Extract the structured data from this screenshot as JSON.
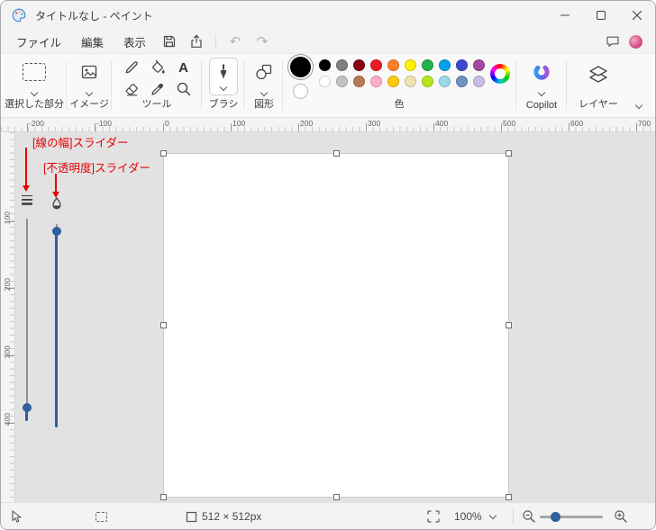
{
  "titlebar": {
    "title": "タイトルなし - ペイント"
  },
  "menubar": {
    "file": "ファイル",
    "edit": "編集",
    "view": "表示"
  },
  "glyphs": {
    "undo": "↶",
    "redo": "↷",
    "text_tool": "A"
  },
  "ribbon": {
    "selection_label": "選択した部分",
    "image_label": "イメージ",
    "tools_label": "ツール",
    "brushes_label": "ブラシ",
    "shapes_label": "図形",
    "colors_label": "色",
    "copilot_label": "Copilot",
    "layers_label": "レイヤー",
    "color1": "#000000",
    "color2": "#ffffff",
    "palette_row1": [
      "#000000",
      "#7f7f7f",
      "#880015",
      "#ed1c24",
      "#ff7f27",
      "#fff200",
      "#22b14c",
      "#00a2e8",
      "#3f48cc",
      "#a349a4"
    ],
    "palette_row2": [
      "#ffffff",
      "#c3c3c3",
      "#b97a57",
      "#ffaec9",
      "#ffc90e",
      "#efe4b0",
      "#b5e61d",
      "#99d9ea",
      "#7092be",
      "#c8bfe7"
    ]
  },
  "rulers": {
    "h": [
      "-200",
      "-100",
      "0",
      "100",
      "200",
      "300",
      "400",
      "500",
      "600",
      "700"
    ],
    "v": [
      "100",
      "200",
      "300",
      "400"
    ]
  },
  "annotations": {
    "line_width_label": "[線の幅]スライダー",
    "opacity_label": "[不透明度]スライダー",
    "color": "#e60000"
  },
  "statusbar": {
    "canvas_size": "512 × 512px",
    "zoom": "100%"
  },
  "theme": {
    "accent": "#2e5f9e"
  }
}
